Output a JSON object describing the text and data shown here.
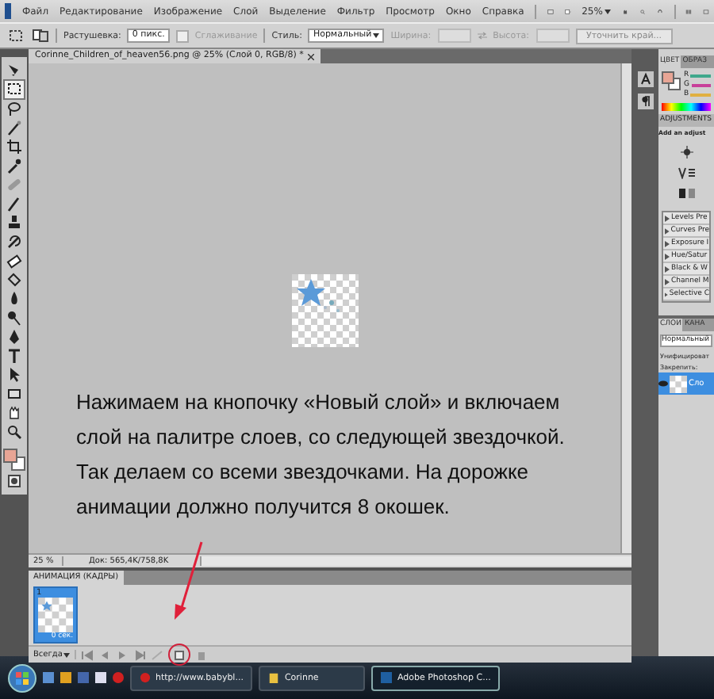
{
  "menu": [
    "Файл",
    "Редактирование",
    "Изображение",
    "Слой",
    "Выделение",
    "Фильтр",
    "Просмотр",
    "Окно",
    "Справка"
  ],
  "app_bar": {
    "zoom": "25%"
  },
  "options": {
    "feather_label": "Растушевка:",
    "feather_value": "0 пикс.",
    "antialias_label": "Сглаживание",
    "antialias_checked": false,
    "style_label": "Стиль:",
    "style_value": "Нормальный",
    "width_label": "Ширина:",
    "height_label": "Высота:",
    "refine_button": "Уточнить край..."
  },
  "tools": [
    {
      "selected": false
    },
    {
      "selected": true
    },
    {
      "selected": false
    },
    {
      "selected": false
    },
    {
      "selected": false
    },
    {
      "selected": false
    },
    {
      "selected": false
    },
    {
      "selected": false
    },
    {
      "selected": false
    },
    {
      "selected": false
    },
    {
      "selected": false
    },
    {
      "selected": false
    },
    {
      "selected": false
    },
    {
      "selected": false
    },
    {
      "selected": false
    },
    {
      "selected": false
    },
    {
      "selected": false
    },
    {
      "selected": false
    },
    {
      "selected": false
    },
    {
      "selected": false
    }
  ],
  "document": {
    "title": "Corinne_Children_of_heaven56.png @ 25% (Слой 0, RGB/8) *"
  },
  "instruction": "Нажимаем на кнопочку «Новый слой» и включаем слой на палитре слоев, со следующей звездочкой. Так делаем со всеми звездочками. На дорожке анимации должно получится 8 окошек.",
  "status_bar": {
    "zoom": "25 %",
    "doc_size": "Док: 565,4K/758,8K"
  },
  "animation": {
    "title": "АНИМАЦИЯ (КАДРЫ)",
    "frames": [
      {
        "number": "1",
        "delay": "0 сек.",
        "selected": true
      }
    ],
    "loop": "Всегда"
  },
  "color_panel": {
    "tabs": [
      {
        "label": "ЦВЕТ",
        "selected": true
      },
      {
        "label": "ОБРАЗ",
        "selected": false
      }
    ],
    "channels": [
      {
        "label": "R",
        "color": "#3fa88c"
      },
      {
        "label": "G",
        "color": "#c8409a"
      },
      {
        "label": "B",
        "color": "#e0b040"
      }
    ]
  },
  "adjustments_panel": {
    "title": "ADJUSTMENTS",
    "hint": "Add an adjust",
    "presets": [
      "Levels Pre",
      "Curves Pre",
      "Exposure I",
      "Hue/Satur",
      "Black & W",
      "Channel M",
      "Selective C"
    ]
  },
  "layers_panel": {
    "tabs": [
      {
        "label": "СЛОИ",
        "selected": true
      },
      {
        "label": "КАНА",
        "selected": false
      }
    ],
    "blend_mode": "Нормальный",
    "unify_label": "Унифицироват",
    "lock_label": "Закрепить:",
    "layers": [
      {
        "name": "Сло",
        "visible": true,
        "selected": true
      }
    ]
  },
  "taskbar": {
    "tasks": [
      {
        "label": "http://www.babybl...",
        "active": false,
        "kind": "browser"
      },
      {
        "label": "Corinne",
        "active": false,
        "kind": "folder"
      },
      {
        "label": "Adobe Photoshop C...",
        "active": true,
        "kind": "photoshop"
      }
    ]
  }
}
